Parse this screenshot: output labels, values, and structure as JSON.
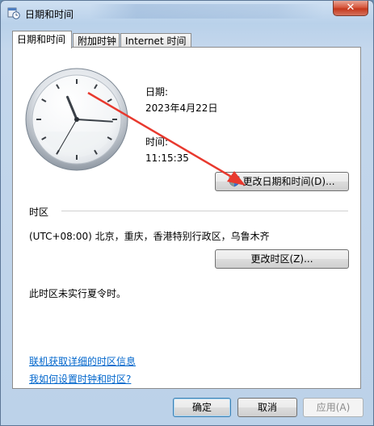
{
  "window": {
    "title": "日期和时间",
    "close_label": "✕"
  },
  "tabs": [
    {
      "label": "日期和时间",
      "active": true
    },
    {
      "label": "附加时钟",
      "active": false
    },
    {
      "label": "Internet 时间",
      "active": false
    }
  ],
  "clock": {
    "time_shown": "11:15:35"
  },
  "date": {
    "label": "日期:",
    "value": "2023年4月22日"
  },
  "time": {
    "label": "时间:",
    "value": "11:15:35"
  },
  "buttons": {
    "change_datetime": "更改日期和时间(D)...",
    "change_timezone": "更改时区(Z)...",
    "ok": "确定",
    "cancel": "取消",
    "apply": "应用(A)"
  },
  "timezone": {
    "section_label": "时区",
    "value": "(UTC+08:00) 北京，重庆，香港特别行政区，乌鲁木齐",
    "dst_note": "此时区未实行夏令时。"
  },
  "links": {
    "online_info": "联机获取详细的时区信息",
    "how_to": "我如何设置时钟和时区?"
  },
  "colors": {
    "link": "#0066cc",
    "annotation_arrow": "#e8392e"
  }
}
